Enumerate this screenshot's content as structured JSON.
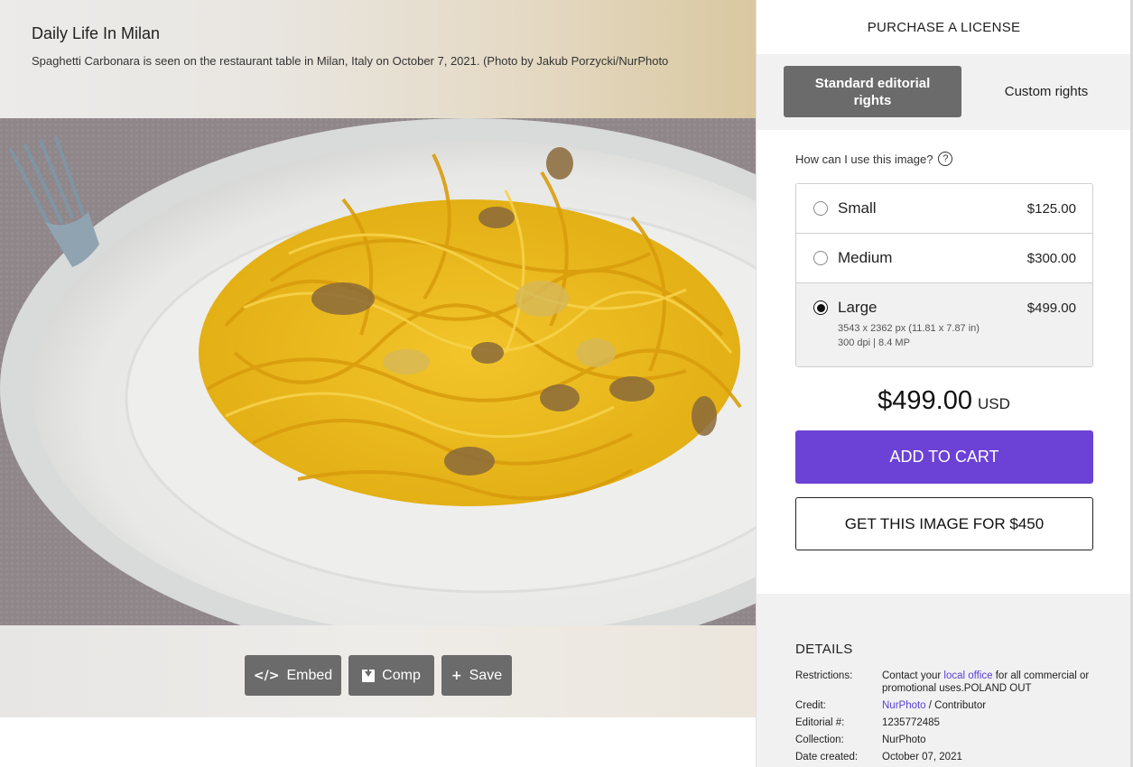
{
  "caption": {
    "title": "Daily Life In Milan",
    "text": "Spaghetti Carbonara is seen on the restaurant table in Milan, Italy on October 7, 2021. (Photo by Jakub Porzycki/NurPhoto"
  },
  "actions": {
    "embed_label": "Embed",
    "comp_label": "Comp",
    "save_label": "Save"
  },
  "panel": {
    "header": "PURCHASE A LICENSE",
    "tabs": {
      "standard": "Standard editorial rights",
      "custom": "Custom rights"
    },
    "usage_question": "How can I use this image?",
    "options": [
      {
        "label": "Small",
        "price": "$125.00",
        "selected": false
      },
      {
        "label": "Medium",
        "price": "$300.00",
        "selected": false
      },
      {
        "label": "Large",
        "price": "$499.00",
        "selected": true,
        "detail_line1": "3543 x 2362 px (11.81 x 7.87 in)",
        "detail_line2": "300 dpi | 8.4 MP"
      }
    ],
    "total_amount": "$499.00",
    "total_currency": "USD",
    "add_to_cart": "ADD TO CART",
    "get_image": "GET THIS IMAGE FOR $450"
  },
  "details": {
    "title": "DETAILS",
    "restrictions_label": "Restrictions:",
    "restrictions_pre": "Contact your ",
    "restrictions_link": "local office",
    "restrictions_post": " for all commercial or promotional uses.POLAND OUT",
    "credit_label": "Credit:",
    "credit_link": "NurPhoto",
    "credit_post": " / Contributor",
    "editorial_label": "Editorial #:",
    "editorial_value": "1235772485",
    "collection_label": "Collection:",
    "collection_value": "NurPhoto",
    "date_label": "Date created:",
    "date_value": "October 07, 2021"
  },
  "colors": {
    "accent": "#6c41d6",
    "dark_button": "#6b6b6b",
    "link": "#5a3fd6"
  }
}
